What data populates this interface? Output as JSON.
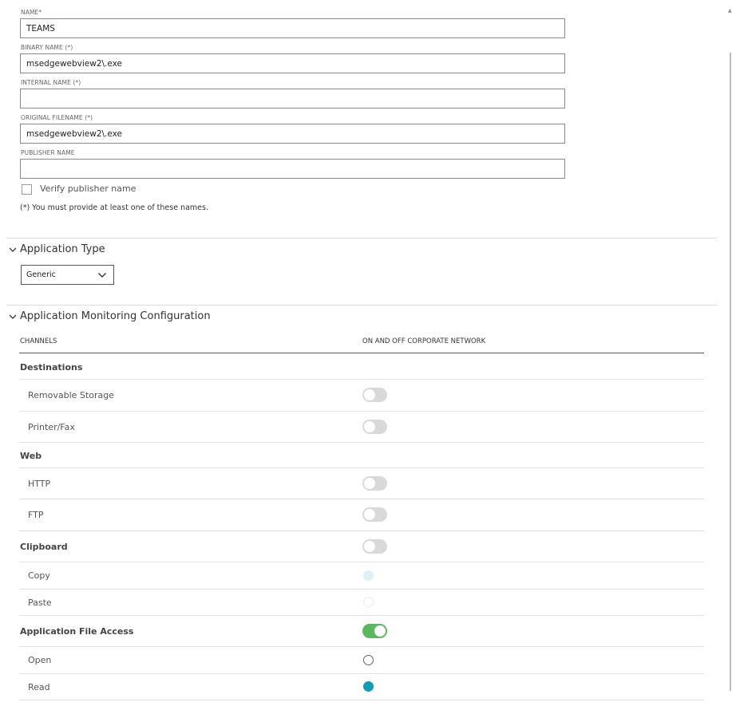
{
  "fields": {
    "name": {
      "label": "NAME*",
      "value": "TEAMS"
    },
    "binary_name": {
      "label": "BINARY NAME (*)",
      "value": "msedgewebview2\\.exe"
    },
    "internal_name": {
      "label": "INTERNAL NAME (*)",
      "value": ""
    },
    "original_filename": {
      "label": "ORIGINAL FILENAME (*)",
      "value": "msedgewebview2\\.exe"
    },
    "publisher_name": {
      "label": "PUBLISHER NAME",
      "value": ""
    }
  },
  "verify_publisher": {
    "label": "Verify publisher name",
    "checked": false
  },
  "note": "(*) You must provide at least one of these names.",
  "application_type": {
    "title": "Application Type",
    "selected": "Generic"
  },
  "monitoring": {
    "title": "Application Monitoring Configuration",
    "columns": [
      "CHANNELS",
      "ON AND OFF CORPORATE NETWORK"
    ],
    "rows": [
      {
        "label": "Destinations",
        "kind": "group",
        "control": "none"
      },
      {
        "label": "Removable Storage",
        "kind": "sub",
        "control": "toggle",
        "state": "off"
      },
      {
        "label": "Printer/Fax",
        "kind": "sub",
        "control": "toggle",
        "state": "off"
      },
      {
        "label": "Web",
        "kind": "group",
        "control": "none"
      },
      {
        "label": "HTTP",
        "kind": "sub",
        "control": "toggle",
        "state": "off"
      },
      {
        "label": "FTP",
        "kind": "sub",
        "control": "toggle",
        "state": "off"
      },
      {
        "label": "Clipboard",
        "kind": "group",
        "control": "toggle",
        "state": "off"
      },
      {
        "label": "Copy",
        "kind": "sub",
        "control": "radio",
        "state": "disabled-selected"
      },
      {
        "label": "Paste",
        "kind": "sub",
        "control": "radio",
        "state": "disabled-unselected"
      },
      {
        "label": "Application File Access",
        "kind": "group",
        "control": "toggle",
        "state": "on"
      },
      {
        "label": "Open",
        "kind": "sub",
        "control": "radio",
        "state": "unselected"
      },
      {
        "label": "Read",
        "kind": "sub",
        "control": "radio",
        "state": "selected"
      }
    ]
  },
  "colors": {
    "toggle_on": "#5cb85c",
    "toggle_off": "#d9d9d9",
    "radio_selected": "#0f9cb5"
  }
}
